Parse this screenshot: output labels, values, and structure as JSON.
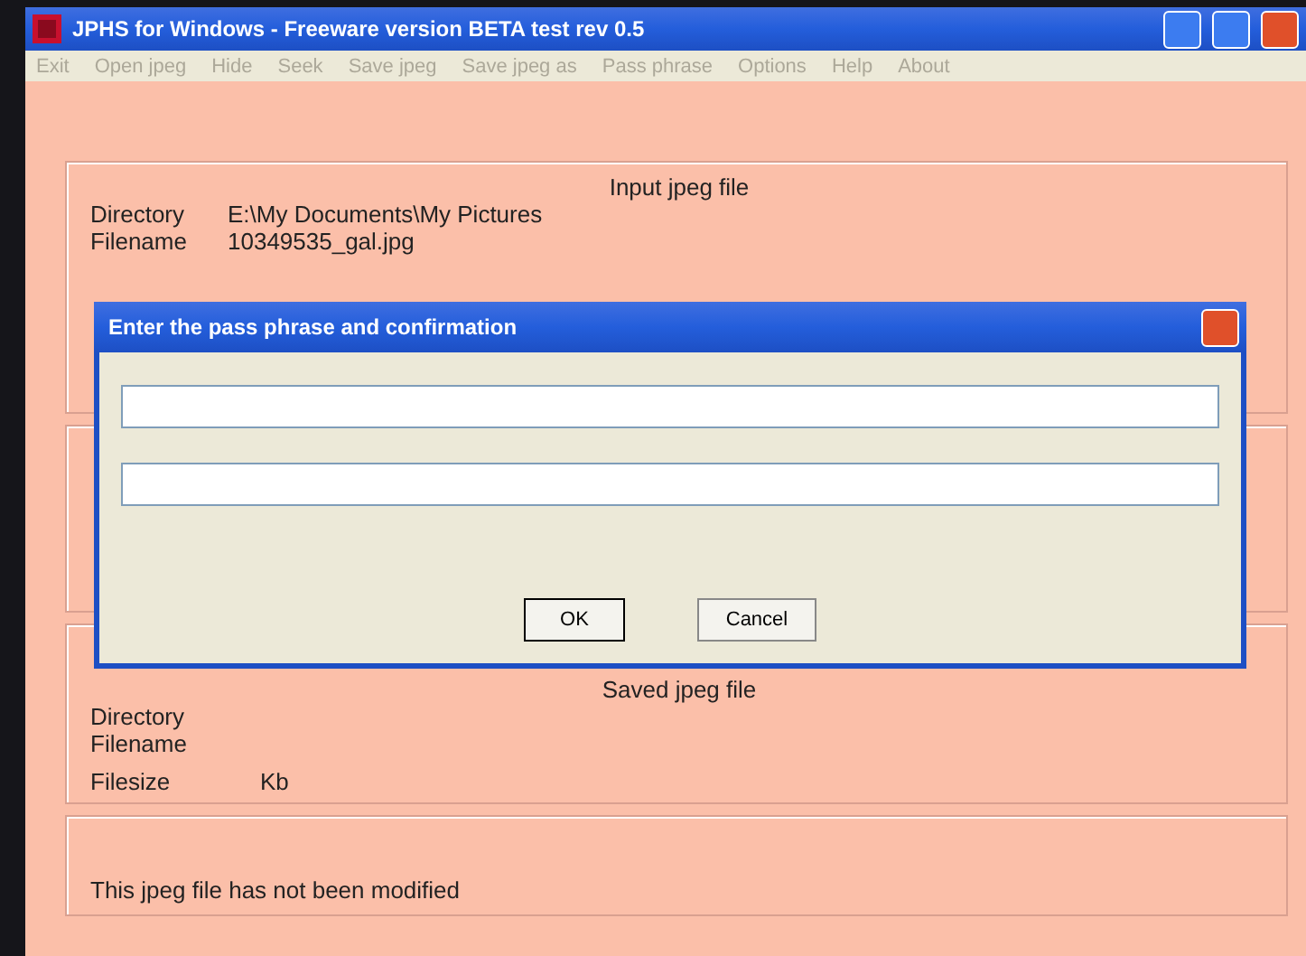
{
  "window": {
    "title": "JPHS for Windows - Freeware version BETA test rev 0.5"
  },
  "menu": [
    {
      "label": "Exit",
      "disabled": true
    },
    {
      "label": "Open jpeg",
      "disabled": true
    },
    {
      "label": "Hide",
      "disabled": true
    },
    {
      "label": "Seek",
      "disabled": true
    },
    {
      "label": "Save jpeg",
      "disabled": true
    },
    {
      "label": "Save jpeg as",
      "disabled": true
    },
    {
      "label": "Pass phrase",
      "disabled": true
    },
    {
      "label": "Options",
      "disabled": true
    },
    {
      "label": "Help",
      "disabled": true
    },
    {
      "label": "About",
      "disabled": true
    }
  ],
  "input_panel": {
    "heading": "Input jpeg file",
    "directory_label": "Directory",
    "directory": "E:\\My Documents\\My Pictures",
    "filename_label": "Filename",
    "filename": "10349535_gal.jpg"
  },
  "saved_panel": {
    "heading": "Saved jpeg file",
    "directory_label": "Directory",
    "filename_label": "Filename",
    "filesize_label": "Filesize",
    "filesize_unit": "Kb"
  },
  "status": "This jpeg file has not been modified",
  "dialog": {
    "title": "Enter the pass phrase and confirmation",
    "buttons": [
      "OK",
      "Cancel"
    ]
  }
}
